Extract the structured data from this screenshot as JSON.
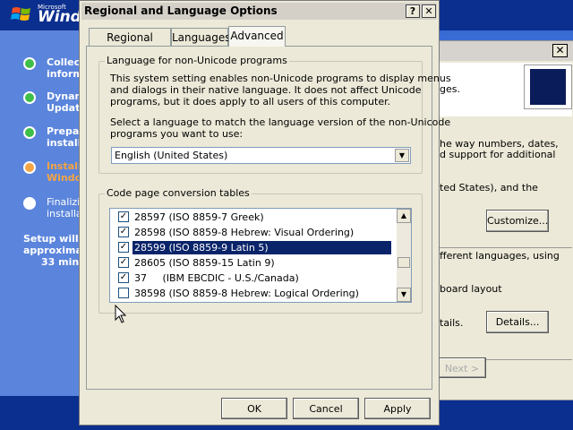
{
  "setup": {
    "logo_small": "Microsoft",
    "logo_large": "Windo",
    "steps": [
      {
        "label": "Collect",
        "label2": "inform",
        "state": "done"
      },
      {
        "label": "Dynam",
        "label2": "Update",
        "state": "done"
      },
      {
        "label": "Prepar",
        "label2": "installa",
        "state": "done"
      },
      {
        "label": "Install",
        "label2": "Windo",
        "state": "current"
      },
      {
        "label": "Finalizi",
        "label2": "installa",
        "state": "todo"
      }
    ],
    "note_lines": [
      "Setup will c",
      "approximat",
      "33 minu"
    ]
  },
  "bg_dialog": {
    "close_label": "✕",
    "lines": [
      "ges.",
      "he way numbers, dates,",
      "d support for additional",
      "ted States), and the",
      "fferent languages, using",
      "board layout",
      "tails."
    ],
    "customize_label": "Customize...",
    "details_label": "Details...",
    "next_label": "Next >"
  },
  "dialog": {
    "title": "Regional and Language Options",
    "help_label": "?",
    "close_label": "✕",
    "tabs": [
      "Regional Options",
      "Languages",
      "Advanced"
    ],
    "active_tab": "Advanced",
    "group1": {
      "label": "Language for non-Unicode programs",
      "desc": [
        "This system setting enables non-Unicode programs to display menus",
        "and dialogs in their native language. It does not affect Unicode",
        "programs, but it does apply to all users of this computer."
      ],
      "prompt": [
        "Select a language to match the language version of the non-Unicode",
        "programs you want to use:"
      ],
      "selected_language": "English (United States)"
    },
    "group2": {
      "label": "Code page conversion tables",
      "items": [
        {
          "text": "28597 (ISO 8859-7 Greek)",
          "checked": true,
          "selected": false
        },
        {
          "text": "28598 (ISO 8859-8 Hebrew: Visual Ordering)",
          "checked": true,
          "selected": false
        },
        {
          "text": "28599 (ISO 8859-9 Latin 5)",
          "checked": true,
          "selected": true
        },
        {
          "text": "28605 (ISO 8859-15 Latin 9)",
          "checked": true,
          "selected": false
        },
        {
          "text": "37     (IBM EBCDIC - U.S./Canada)",
          "checked": true,
          "selected": false
        },
        {
          "text": "38598 (ISO 8859-8 Hebrew: Logical Ordering)",
          "checked": false,
          "selected": false
        }
      ]
    },
    "buttons": {
      "ok": "OK",
      "cancel": "Cancel",
      "apply": "Apply"
    }
  }
}
